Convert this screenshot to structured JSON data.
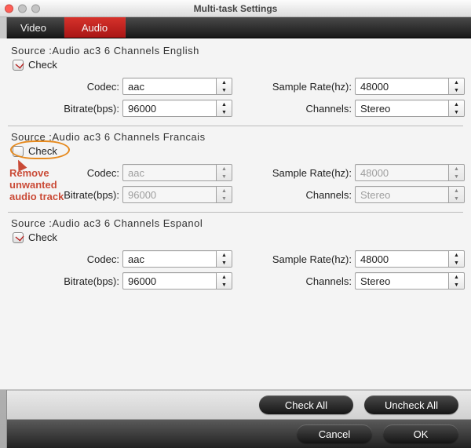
{
  "window": {
    "title": "Multi-task Settings"
  },
  "tabs": {
    "video": "Video",
    "audio": "Audio",
    "active": "Audio"
  },
  "labels": {
    "check": "Check",
    "codec": "Codec:",
    "bitrate": "Bitrate(bps):",
    "sample_rate": "Sample Rate(hz):",
    "channels": "Channels:"
  },
  "tracks": [
    {
      "source": "Source :Audio  ac3  6 Channels  English",
      "checked": true,
      "codec": "aac",
      "bitrate": "96000",
      "sample_rate": "48000",
      "channels": "Stereo"
    },
    {
      "source": "Source :Audio  ac3  6 Channels  Francais",
      "checked": false,
      "codec": "aac",
      "bitrate": "96000",
      "sample_rate": "48000",
      "channels": "Stereo"
    },
    {
      "source": "Source :Audio  ac3  6 Channels  Espanol",
      "checked": true,
      "codec": "aac",
      "bitrate": "96000",
      "sample_rate": "48000",
      "channels": "Stereo"
    }
  ],
  "annotation": {
    "line1": "Remove",
    "line2": "unwanted",
    "line3": "audio track"
  },
  "buttons": {
    "check_all": "Check All",
    "uncheck_all": "Uncheck All",
    "cancel": "Cancel",
    "ok": "OK"
  }
}
